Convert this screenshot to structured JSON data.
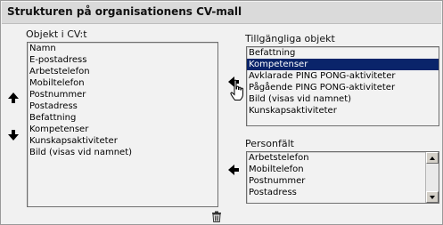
{
  "title": "Strukturen på organisationens CV-mall",
  "cv_objects": {
    "label": "Objekt i CV:t",
    "items": [
      "Namn",
      "E-postadress",
      "Arbetstelefon",
      "Mobiltelefon",
      "Postnummer",
      "Postadress",
      "Befattning",
      "Kompetenser",
      "Kunskapsaktiviteter",
      "Bild (visas vid namnet)"
    ]
  },
  "available_objects": {
    "label": "Tillgängliga objekt",
    "items": [
      "Befattning",
      "Kompetenser",
      "Avklarade PING PONG-aktiviteter",
      "Pågående PING PONG-aktiviteter",
      "Bild (visas vid namnet)",
      "Kunskapsaktiviteter"
    ],
    "selected": "Kompetenser"
  },
  "person_fields": {
    "label": "Personfält",
    "items": [
      "Arbetstelefon",
      "Mobiltelefon",
      "Postnummer",
      "Postadress"
    ]
  },
  "icons": {
    "move_up": "arrow-up-icon",
    "move_down": "arrow-down-icon",
    "add_from_available": "arrow-left-icon",
    "add_from_personfields": "arrow-left-icon",
    "delete": "trash-icon",
    "cursor": "hand-pointer-icon"
  },
  "colors": {
    "selection": "#0a246a",
    "title_bar": "#dadada"
  }
}
